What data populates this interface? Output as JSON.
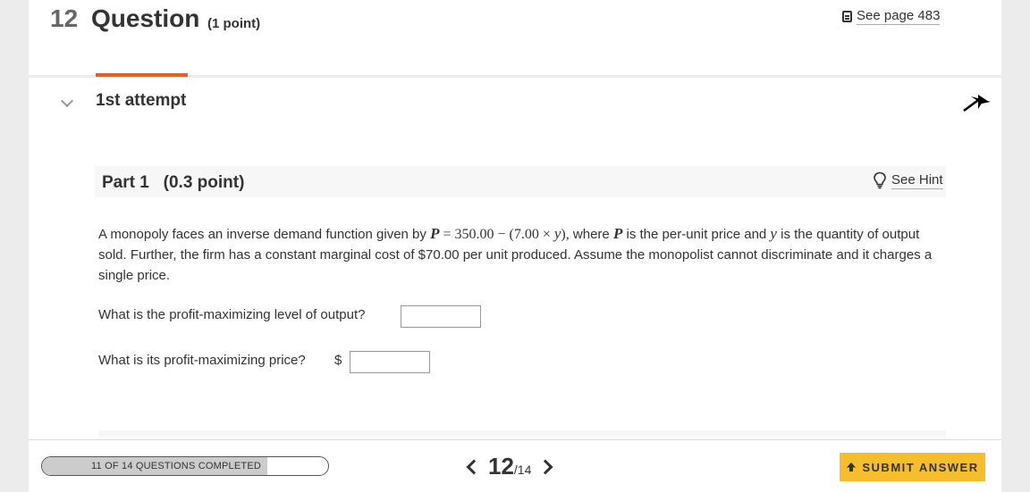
{
  "header": {
    "question_number": "12",
    "question_word": "Question",
    "points": "(1 point)",
    "see_page": "See page 483"
  },
  "attempt": {
    "label": "1st attempt"
  },
  "part": {
    "label": "Part 1   (0.3 point)",
    "hint": "See Hint"
  },
  "question": {
    "text_a": "A monopoly faces an inverse demand function given by ",
    "var_p": "P",
    "eq_a": " = 350.00 − (7.00 × ",
    "var_y": "y",
    "eq_b": "),",
    "text_b": " where ",
    "var_p2": "P",
    "text_c": " is the per-unit price and ",
    "var_y2": "y",
    "text_d": " is the quantity of output sold. Further, the firm has a constant marginal cost of $70.00 per unit produced. Assume the monopolist cannot discriminate and it charges a single price."
  },
  "items": {
    "output_label": "What is the profit-maximizing level of output?",
    "output_value": "",
    "price_label": "What is its profit-maximizing price?",
    "currency": "$",
    "price_value": ""
  },
  "footer": {
    "progress_text": "11 OF 14 QUESTIONS COMPLETED",
    "completed_fraction": 0.786,
    "page_current": "12",
    "page_total": "/14",
    "submit": "SUBMIT ANSWER"
  },
  "colors": {
    "accent": "#f15a24",
    "link_underline": "#e8b100",
    "submit_bg": "#f6bd2d"
  },
  "icons": [
    "book-icon",
    "chevron-down-icon",
    "pin-icon",
    "lightbulb-icon",
    "chevron-left-icon",
    "chevron-right-icon",
    "upload-icon"
  ]
}
